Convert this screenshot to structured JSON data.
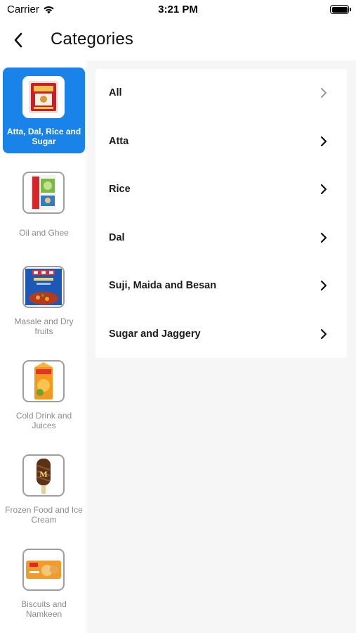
{
  "status_bar": {
    "carrier": "Carrier",
    "time": "3:21 PM",
    "wifi_icon": "wifi-icon",
    "battery_icon": "battery-icon"
  },
  "header": {
    "title": "Categories",
    "back_icon": "chevron-left-icon"
  },
  "colors": {
    "accent": "#1a83ea",
    "background": "#f6f6f6",
    "inactive_text": "#8c8c8c"
  },
  "sidebar": {
    "items": [
      {
        "label": "Atta, Dal, Rice and Sugar",
        "icon": "atta-pack-icon",
        "selected": true
      },
      {
        "label": "Oil and Ghee",
        "icon": "oil-pack-icon",
        "selected": false
      },
      {
        "label": "Masale and Dry fruits",
        "icon": "masala-box-icon",
        "selected": false
      },
      {
        "label": "Cold Drink and Juices",
        "icon": "juice-carton-icon",
        "selected": false
      },
      {
        "label": "Frozen Food and Ice Cream",
        "icon": "ice-cream-bar-icon",
        "selected": false
      },
      {
        "label": "Biscuits and Namkeen",
        "icon": "biscuit-pack-icon",
        "selected": false
      }
    ]
  },
  "subcategories": {
    "items": [
      {
        "label": "All"
      },
      {
        "label": "Atta"
      },
      {
        "label": "Rice"
      },
      {
        "label": "Dal"
      },
      {
        "label": "Suji, Maida and Besan"
      },
      {
        "label": "Sugar and Jaggery"
      }
    ]
  }
}
